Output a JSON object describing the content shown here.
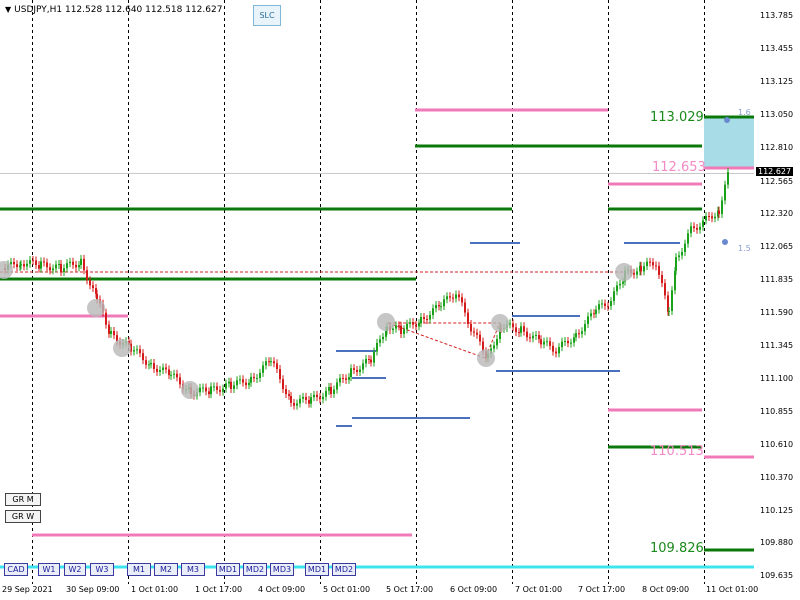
{
  "window": {
    "title": "USDJPY,H1  112.528 112.640 112.518 112.627",
    "slc_label": "SLC"
  },
  "buttons": {
    "gr_m": "GR M",
    "gr_w": "GR W",
    "timeframes": [
      "CAD",
      "W1",
      "W2",
      "W3",
      "M1",
      "M2",
      "M3",
      "MD1",
      "MD2",
      "MD3",
      "MD1",
      "MD2"
    ]
  },
  "levels": [
    {
      "label": "113.029",
      "price": 113.029,
      "color": "#1a8a1a"
    },
    {
      "label": "112.653",
      "price": 112.653,
      "color": "#f28ac4"
    },
    {
      "label": "110.513",
      "price": 110.513,
      "color": "#f28ac4"
    },
    {
      "label": "109.826",
      "price": 109.826,
      "color": "#1a8a1a"
    }
  ],
  "side_labels": [
    "1.6",
    "1.5"
  ],
  "price_axis": {
    "ticks": [
      "113.785",
      "113.455",
      "113.125",
      "113.050",
      "112.810",
      "112.627",
      "112.565",
      "112.320",
      "112.065",
      "111.835",
      "111.590",
      "111.345",
      "111.100",
      "110.855",
      "110.610",
      "110.370",
      "110.125",
      "109.880",
      "109.635"
    ],
    "current": "112.627"
  },
  "time_axis": {
    "ticks": [
      "29 Sep 2021",
      "30 Sep 09:00",
      "1 Oct 01:00",
      "1 Oct 17:00",
      "4 Oct 09:00",
      "5 Oct 01:00",
      "5 Oct 17:00",
      "6 Oct 09:00",
      "7 Oct 01:00",
      "7 Oct 17:00",
      "8 Oct 09:00",
      "11 Oct 01:00"
    ]
  },
  "colors": {
    "up_candle": "#1aa11a",
    "down_candle": "#d41a1a",
    "green_level": "#0a780a",
    "pink_level": "#f07ab8",
    "blue_level": "#4a70c0",
    "cyan_band": "#3ce4f0",
    "target_box": "#a8dce6",
    "grid": "#000000"
  }
}
